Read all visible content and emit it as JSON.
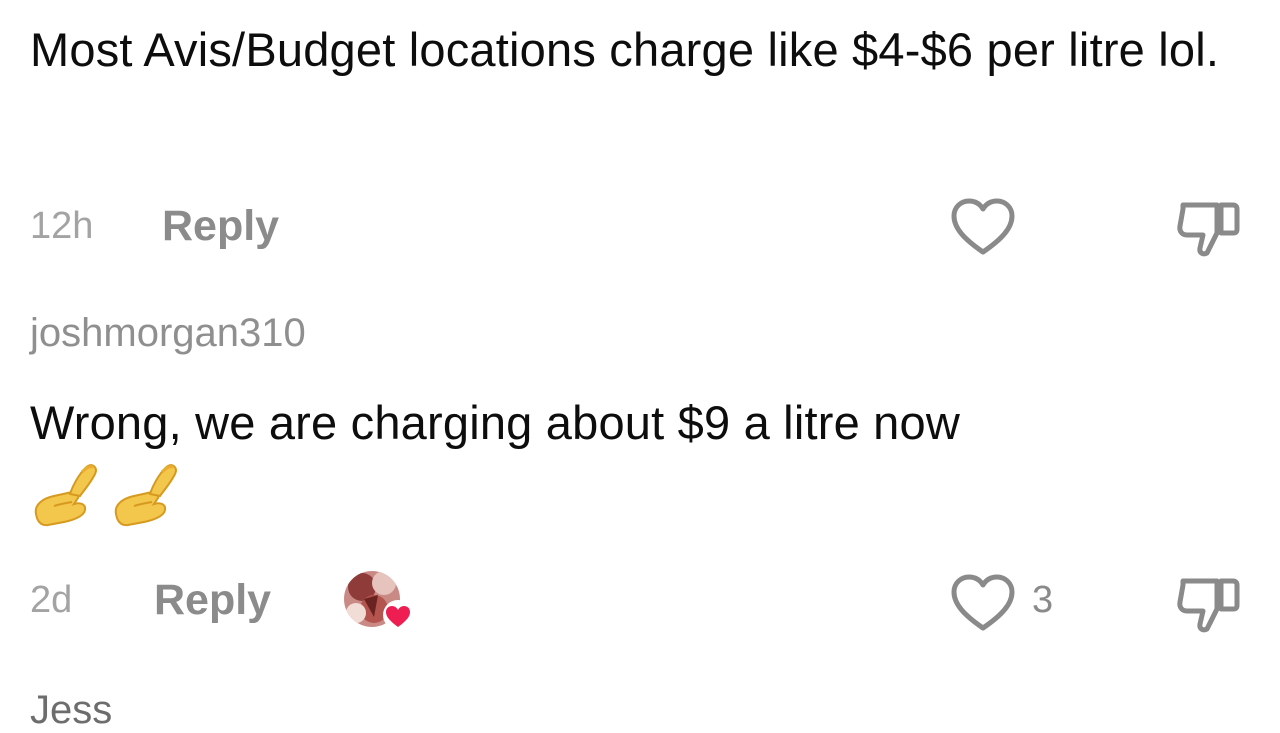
{
  "comments": [
    {
      "text": "Most Avis/Budget locations charge like $4-$6 per litre lol.",
      "time": "12h",
      "reply_label": "Reply",
      "like_count": ""
    },
    {
      "username": "joshmorgan310",
      "text": "Wrong, we are charging about $9 a litre now",
      "emoji": [
        "pinched-fingers-emoji",
        "pinched-fingers-emoji"
      ],
      "time": "2d",
      "reply_label": "Reply",
      "like_count": "3",
      "liked_by_creator": true
    }
  ],
  "next_comment": {
    "username": "Jess"
  },
  "icons": {
    "like": "heart-outline-icon",
    "dislike": "thumbs-down-outline-icon",
    "creator_badge": "red-heart-icon"
  },
  "colors": {
    "text": "#0d0d0d",
    "muted": "#8b8b8b",
    "icon": "#8a8a8a",
    "heart_badge": "#ee1d52"
  }
}
